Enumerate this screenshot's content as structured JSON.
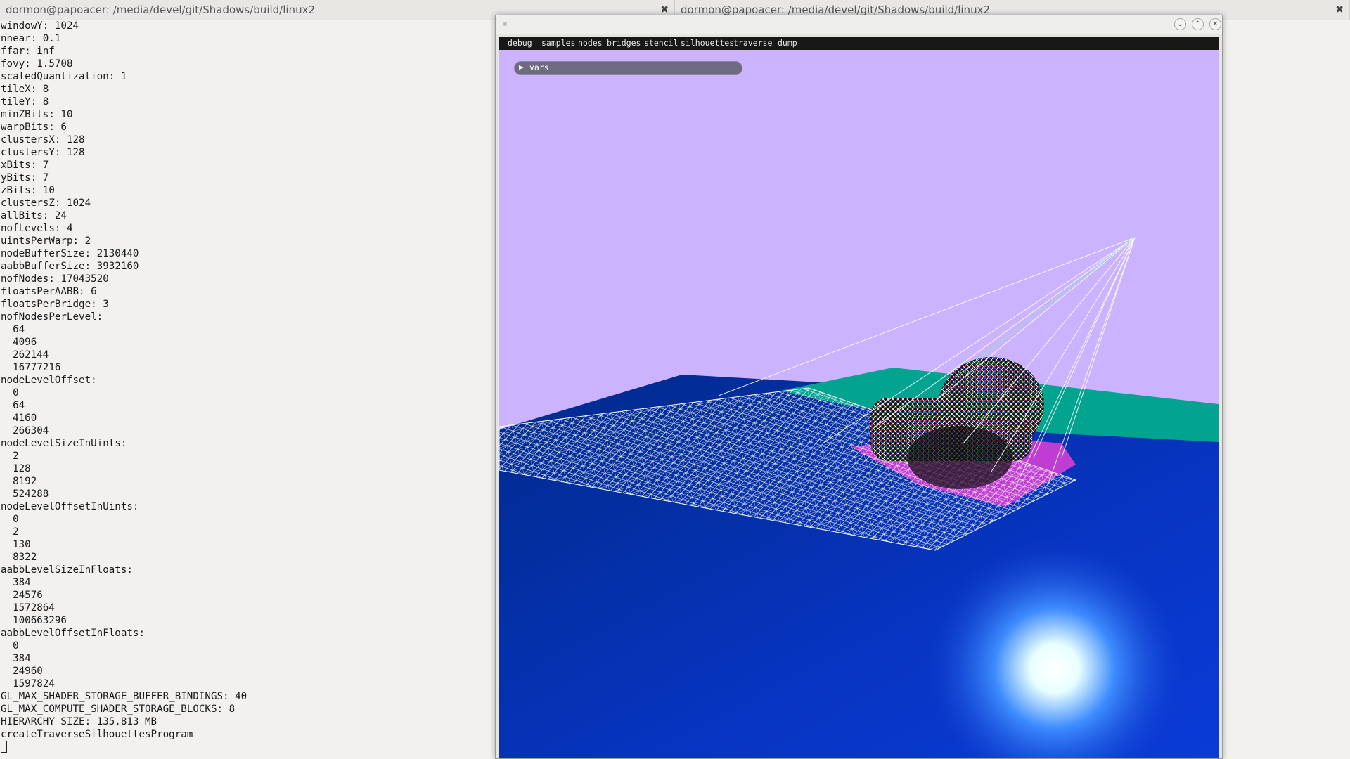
{
  "tabs": [
    {
      "title": "dormon@papoacer: /media/devel/git/Shadows/build/linux2",
      "close": "✖"
    },
    {
      "title": "dormon@papoacer: /media/devel/git/Shadows/build/linux2",
      "close": "✖"
    }
  ],
  "terminal": {
    "lines": [
      "windowY: 1024",
      "nnear: 0.1",
      "ffar: inf",
      "fovy: 1.5708",
      "scaledQuantization: 1",
      "tileX: 8",
      "tileY: 8",
      "minZBits: 10",
      "warpBits: 6",
      "clustersX: 128",
      "clustersY: 128",
      "xBits: 7",
      "yBits: 7",
      "zBits: 10",
      "clustersZ: 1024",
      "allBits: 24",
      "nofLevels: 4",
      "uintsPerWarp: 2",
      "nodeBufferSize: 2130440",
      "aabbBufferSize: 3932160",
      "nofNodes: 17043520",
      "floatsPerAABB: 6",
      "floatsPerBridge: 3",
      "nofNodesPerLevel:",
      "  64",
      "  4096",
      "  262144",
      "  16777216",
      "nodeLevelOffset:",
      "  0",
      "  64",
      "  4160",
      "  266304",
      "nodeLevelSizeInUints:",
      "  2",
      "  128",
      "  8192",
      "  524288",
      "nodeLevelOffsetInUints:",
      "  0",
      "  2",
      "  130",
      "  8322",
      "aabbLevelSizeInFloats:",
      "  384",
      "  24576",
      "  1572864",
      "  100663296",
      "aabbLevelOffsetInFloats:",
      "  0",
      "  384",
      "  24960",
      "  1597824",
      "GL_MAX_SHADER_STORAGE_BUFFER_BINDINGS: 40",
      "GL_MAX_COMPUTE_SHADER_STORAGE_BLOCKS: 8",
      "HIERARCHY SIZE: 135.813 MB",
      "createTraverseSilhouettesProgram"
    ]
  },
  "app": {
    "window_buttons": {
      "minimize": "⌄",
      "maximize": "⌃",
      "close": "✕"
    },
    "menu": [
      "debug",
      "samples",
      "nodes",
      "bridges",
      "stencil",
      "silhouettes",
      "traverse",
      "dump"
    ],
    "vars_label": "vars",
    "vars_icon": "▶",
    "colors": {
      "sky": "#ccb3ff",
      "floor": "#0a34c8",
      "ground_plane": "#00a090",
      "wire": "#ffffff",
      "magenta": "#ff40e0"
    }
  }
}
